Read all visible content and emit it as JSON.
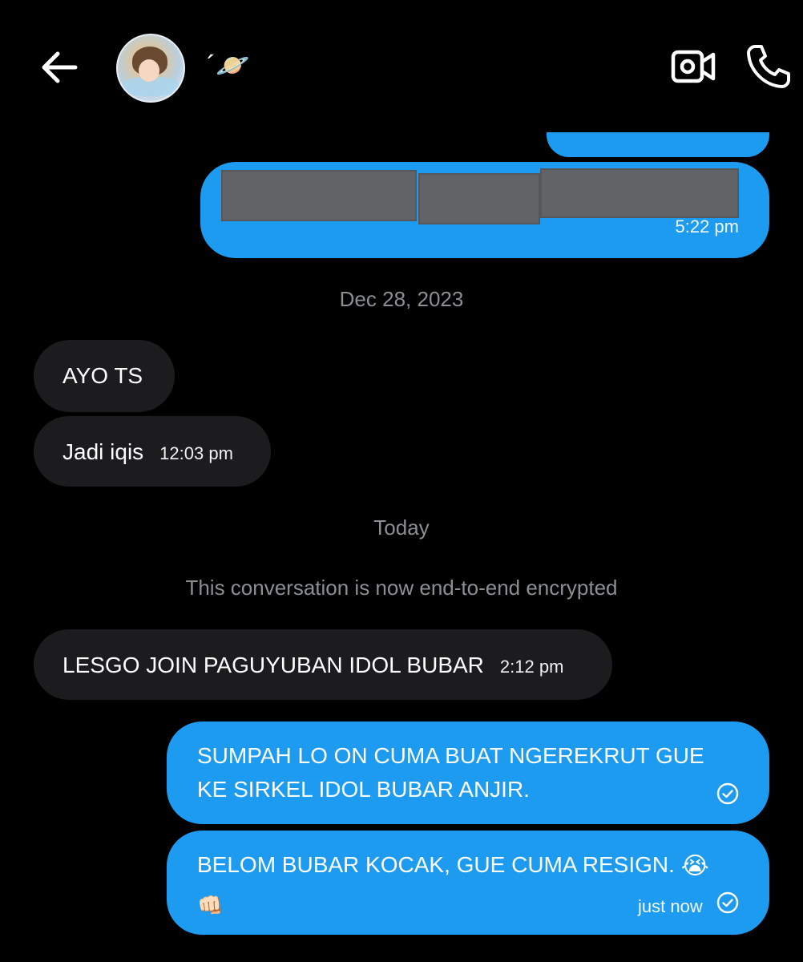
{
  "header": {
    "back_label": "Back",
    "contact_name": "´🪐",
    "video_call_label": "Video call",
    "voice_call_label": "Voice call"
  },
  "icons": {
    "back": "arrow-left-icon",
    "video": "video-camera-icon",
    "call": "phone-icon",
    "sent": "check-circle-icon"
  },
  "colors": {
    "background": "#000000",
    "outgoing_bubble": "#1d9bf0",
    "incoming_bubble": "#1c1c1e",
    "muted_text": "#8b8f94"
  },
  "messages": {
    "media": {
      "time": "5:22 pm"
    },
    "date_separator_1": "Dec 28, 2023",
    "incoming_1": {
      "text": "AYO TS"
    },
    "incoming_2": {
      "text": "Jadi iqis",
      "time": "12:03 pm"
    },
    "date_separator_2": "Today",
    "system_notice": "This conversation is now end-to-end encrypted",
    "incoming_3": {
      "text": "LESGO JOIN PAGUYUBAN IDOL BUBAR",
      "time": "2:12 pm"
    },
    "outgoing_1": {
      "line1": "SUMPAH LO ON CUMA BUAT NGEREKRUT GUE",
      "line2": "KE SIRKEL IDOL BUBAR ANJIR."
    },
    "outgoing_2": {
      "line1": "BELOM BUBAR KOCAK, GUE CUMA RESIGN.",
      "emoji1": "😭",
      "emoji2": "👊🏻",
      "time": "just now"
    }
  }
}
